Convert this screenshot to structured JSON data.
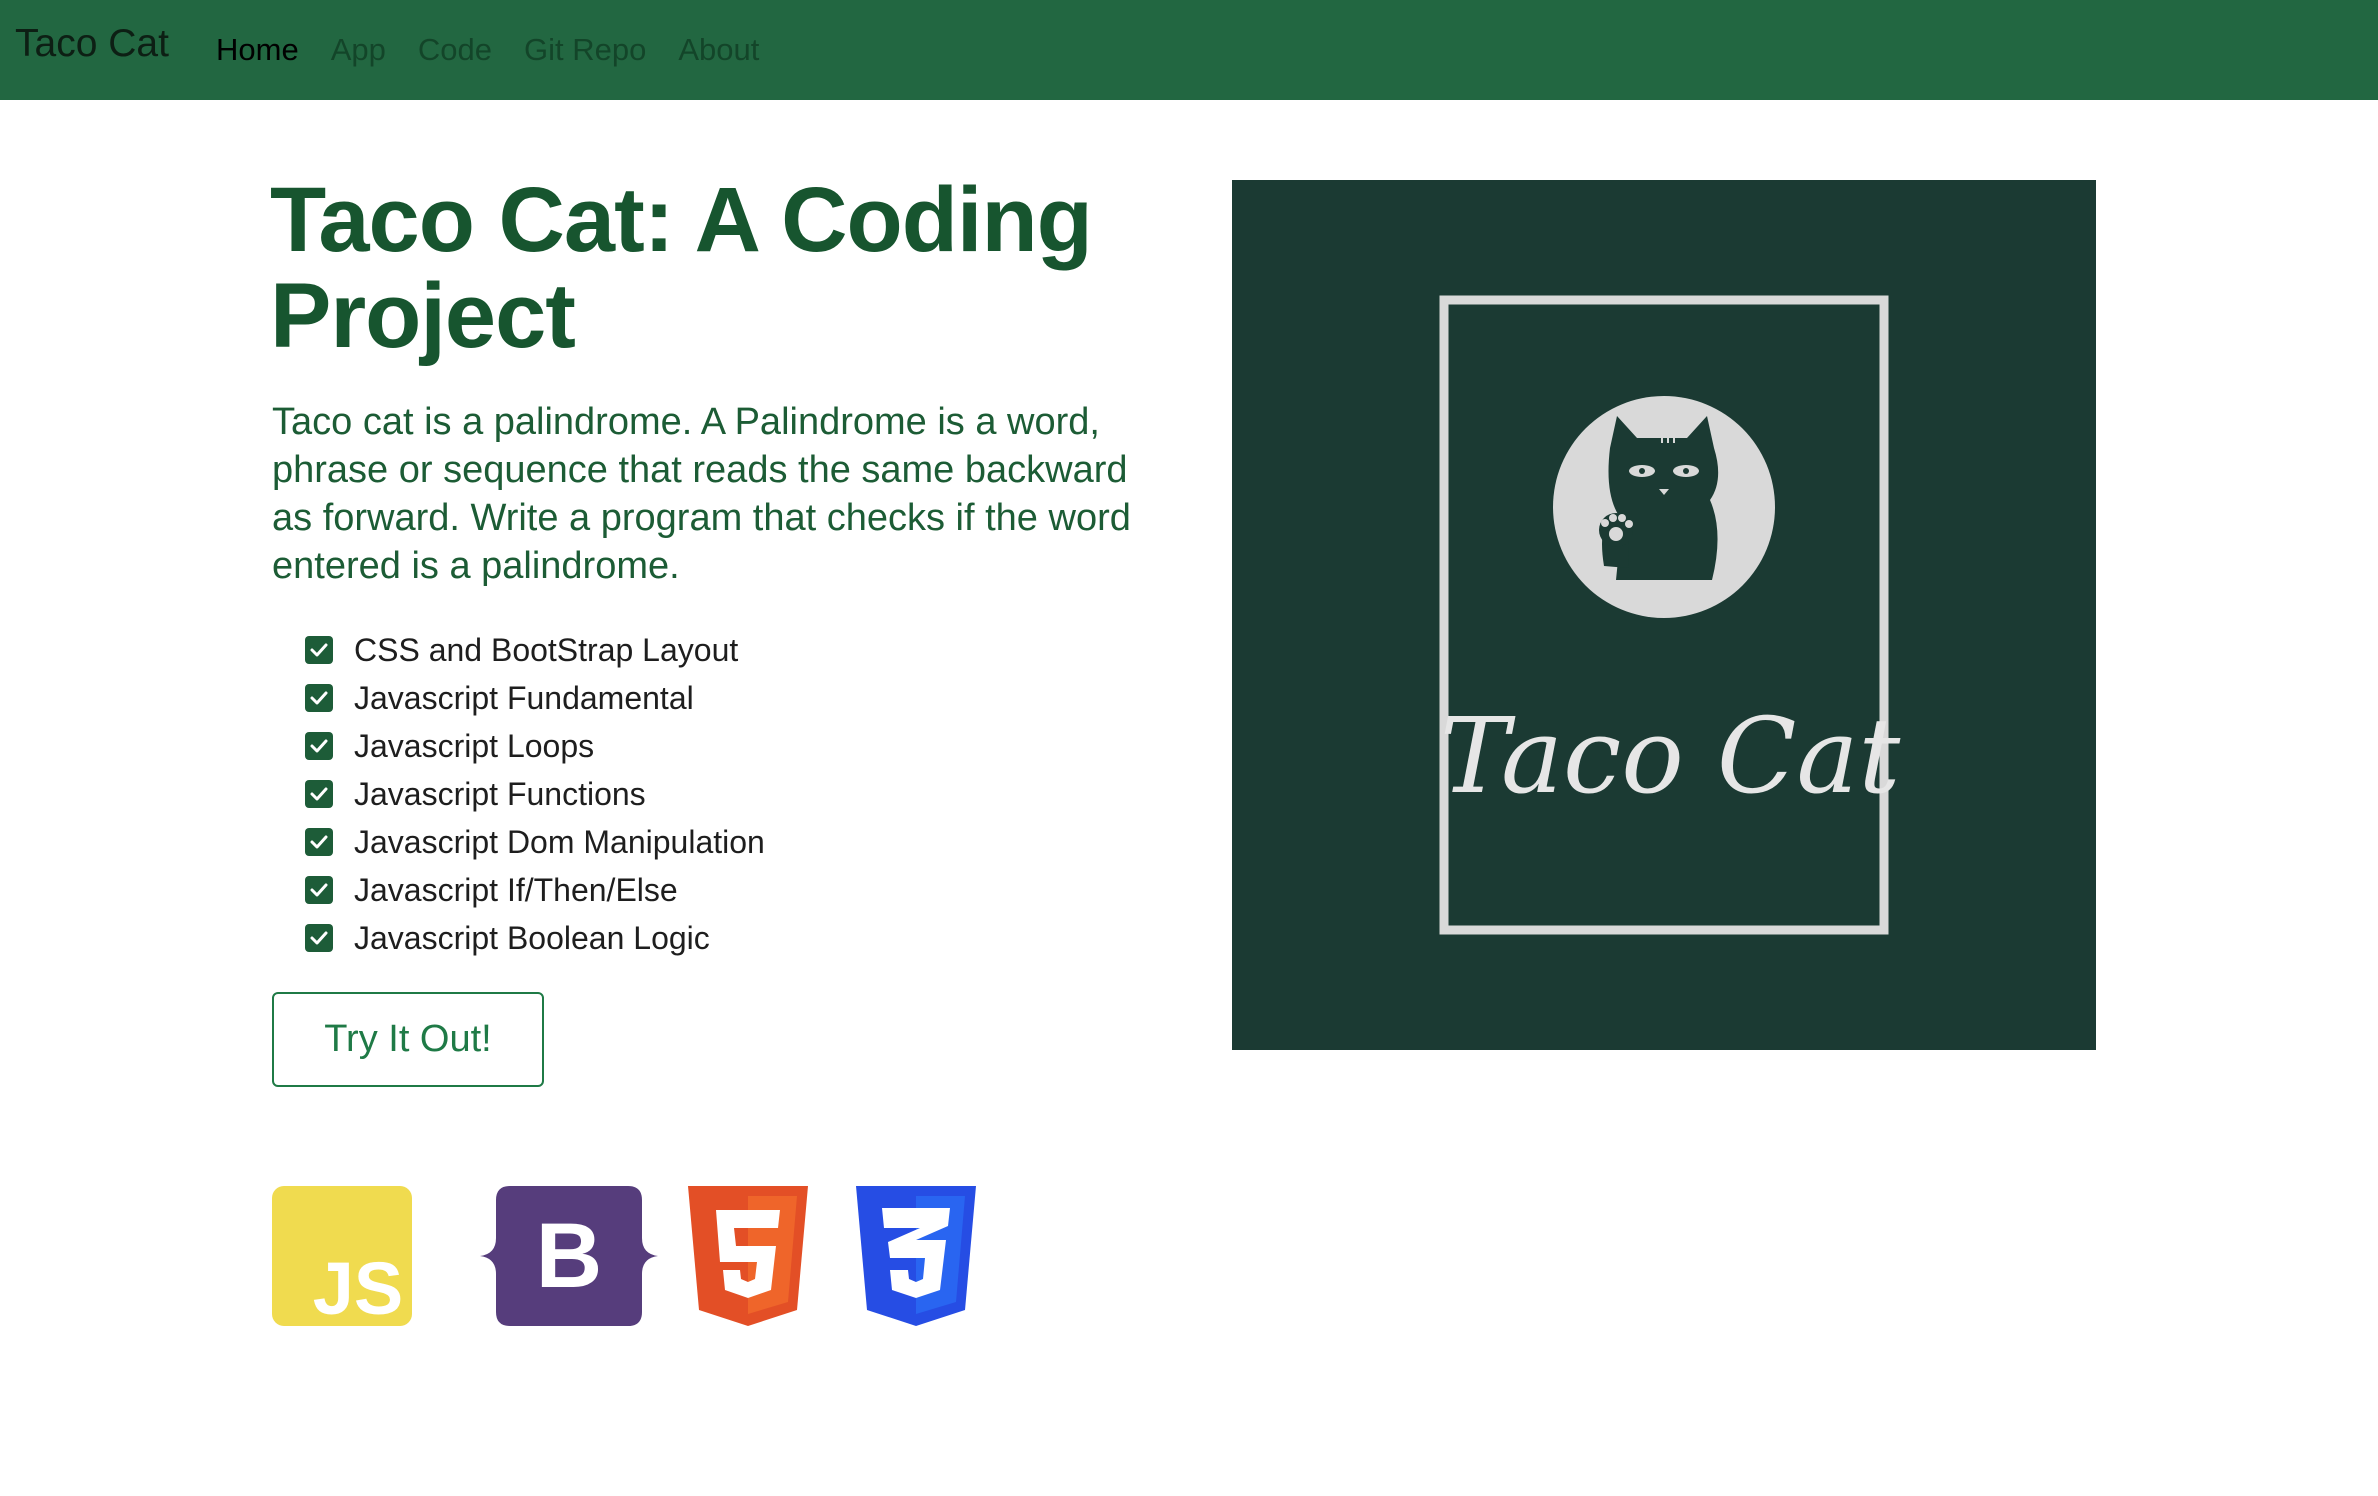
{
  "navbar": {
    "brand": "Taco Cat",
    "links": [
      {
        "label": "Home",
        "active": true
      },
      {
        "label": "App",
        "active": false
      },
      {
        "label": "Code",
        "active": false
      },
      {
        "label": "Git Repo",
        "active": false
      },
      {
        "label": "About",
        "active": false
      }
    ]
  },
  "hero": {
    "title": "Taco Cat: A Coding Project",
    "description": "Taco cat is a palindrome. A Palindrome is a word, phrase or sequence that reads the same backward as forward. Write a program that checks if the word entered is a palindrome.",
    "checklist": [
      "CSS and BootStrap Layout",
      "Javascript Fundamental",
      "Javascript Loops",
      "Javascript Functions",
      "Javascript Dom Manipulation",
      "Javascript If/Then/Else",
      "Javascript Boolean Logic"
    ],
    "button_label": "Try It Out!"
  },
  "logo_image": {
    "text": "Taco Cat",
    "icon": "cat-waving-icon"
  },
  "tech_icons": [
    {
      "name": "javascript-icon",
      "text": "JS",
      "color": "#f0db4f"
    },
    {
      "name": "bootstrap-icon",
      "text": "B",
      "color": "#563d7c"
    },
    {
      "name": "html5-icon",
      "text": "5",
      "color": "#e34f26"
    },
    {
      "name": "css3-icon",
      "text": "3",
      "color": "#264de4"
    }
  ],
  "colors": {
    "navbar": "#226741",
    "title": "#17552f",
    "image_bg": "#1b3a33",
    "accent": "#1f7a46"
  }
}
